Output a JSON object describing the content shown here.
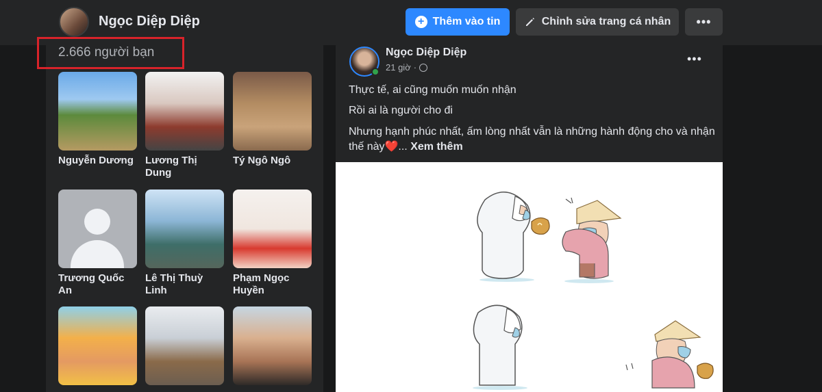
{
  "header": {
    "profile_name": "Ngọc Diệp Diệp",
    "add_story_label": "Thêm vào tin",
    "edit_profile_label": "Chỉnh sửa trang cá nhân",
    "more_label": "•••"
  },
  "friends": {
    "count_label": "2.666 người bạn",
    "items": [
      {
        "name": "Nguyễn Dương"
      },
      {
        "name": "Lương Thị Dung"
      },
      {
        "name": "Tý Ngô Ngô"
      },
      {
        "name": "Trương Quốc An"
      },
      {
        "name": "Lê Thị Thuỳ Linh"
      },
      {
        "name": "Phạm Ngọc Huyền"
      },
      {
        "name": ""
      },
      {
        "name": ""
      },
      {
        "name": ""
      }
    ]
  },
  "post": {
    "author": "Ngọc Diệp Diệp",
    "time": "21 giờ",
    "more_label": "•••",
    "line1": "Thực tế, ai cũng muốn muốn nhận",
    "line2": "Rồi ai là người cho đi",
    "line3": "Nhưng hạnh phúc nhất, ấm lòng nhất vẫn là những hành động cho và nhận thế này",
    "heart": "❤️",
    "ellipsis": "...",
    "see_more": "Xem thêm"
  },
  "colors": {
    "accent": "#2d88ff",
    "highlight": "#d8232a",
    "online": "#31a24c"
  }
}
